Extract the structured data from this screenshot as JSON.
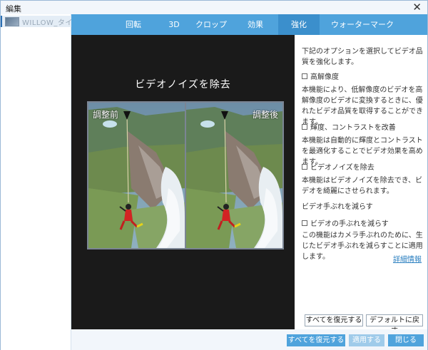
{
  "window": {
    "title": "編集",
    "close_glyph": "✕"
  },
  "sidebar": {
    "file_name": "WILLOW_タイ"
  },
  "tabs": [
    {
      "label": "回転"
    },
    {
      "label": "3D"
    },
    {
      "label": "クロップ"
    },
    {
      "label": "効果"
    },
    {
      "label": "強化"
    },
    {
      "label": "ウォーターマーク"
    }
  ],
  "active_tab": "強化",
  "preview": {
    "title": "ビデオノイズを除去",
    "before_label": "調整前",
    "after_label": "調整後"
  },
  "panel": {
    "intro": "下記のオプションを選択してビデオ品質を強化します。",
    "options": [
      {
        "label": "高解像度",
        "checked": false,
        "description": "本機能により、低解像度のビデオを高解像度のビデオに変換するときに、優れたビデオ品質を取得することができます。"
      },
      {
        "label": "輝度、コントラストを改善",
        "checked": false,
        "description": "本機能は自動的に輝度とコントラストを最適化することでビデオ効果を高めます。"
      },
      {
        "label": "ビデオノイズを除去",
        "checked": false,
        "description": "本機能はビデオノイズを除去でき、ビデオを綺麗にさせられます。"
      }
    ],
    "shake_heading": "ビデオ手ぶれを減らす",
    "shake_option": {
      "label": "ビデオの手ぶれを減らす",
      "checked": false
    },
    "shake_description": "この機能はカメラ手ぶれのために、生じたビデオ手ぶれを減らすことに適用します。",
    "detail_link": "詳細情報",
    "reset_all_label": "すべてを復元する",
    "reset_default_label": "デフォルトに戻す"
  },
  "footer": {
    "restore_all_label": "すべてを復元する",
    "apply_label": "適用する",
    "close_label": "閉じる"
  },
  "colors": {
    "accent": "#4fa3dc",
    "accent_active": "#3b8fcc",
    "preview_bg": "#1a1a1a",
    "link": "#2a7fc0"
  }
}
